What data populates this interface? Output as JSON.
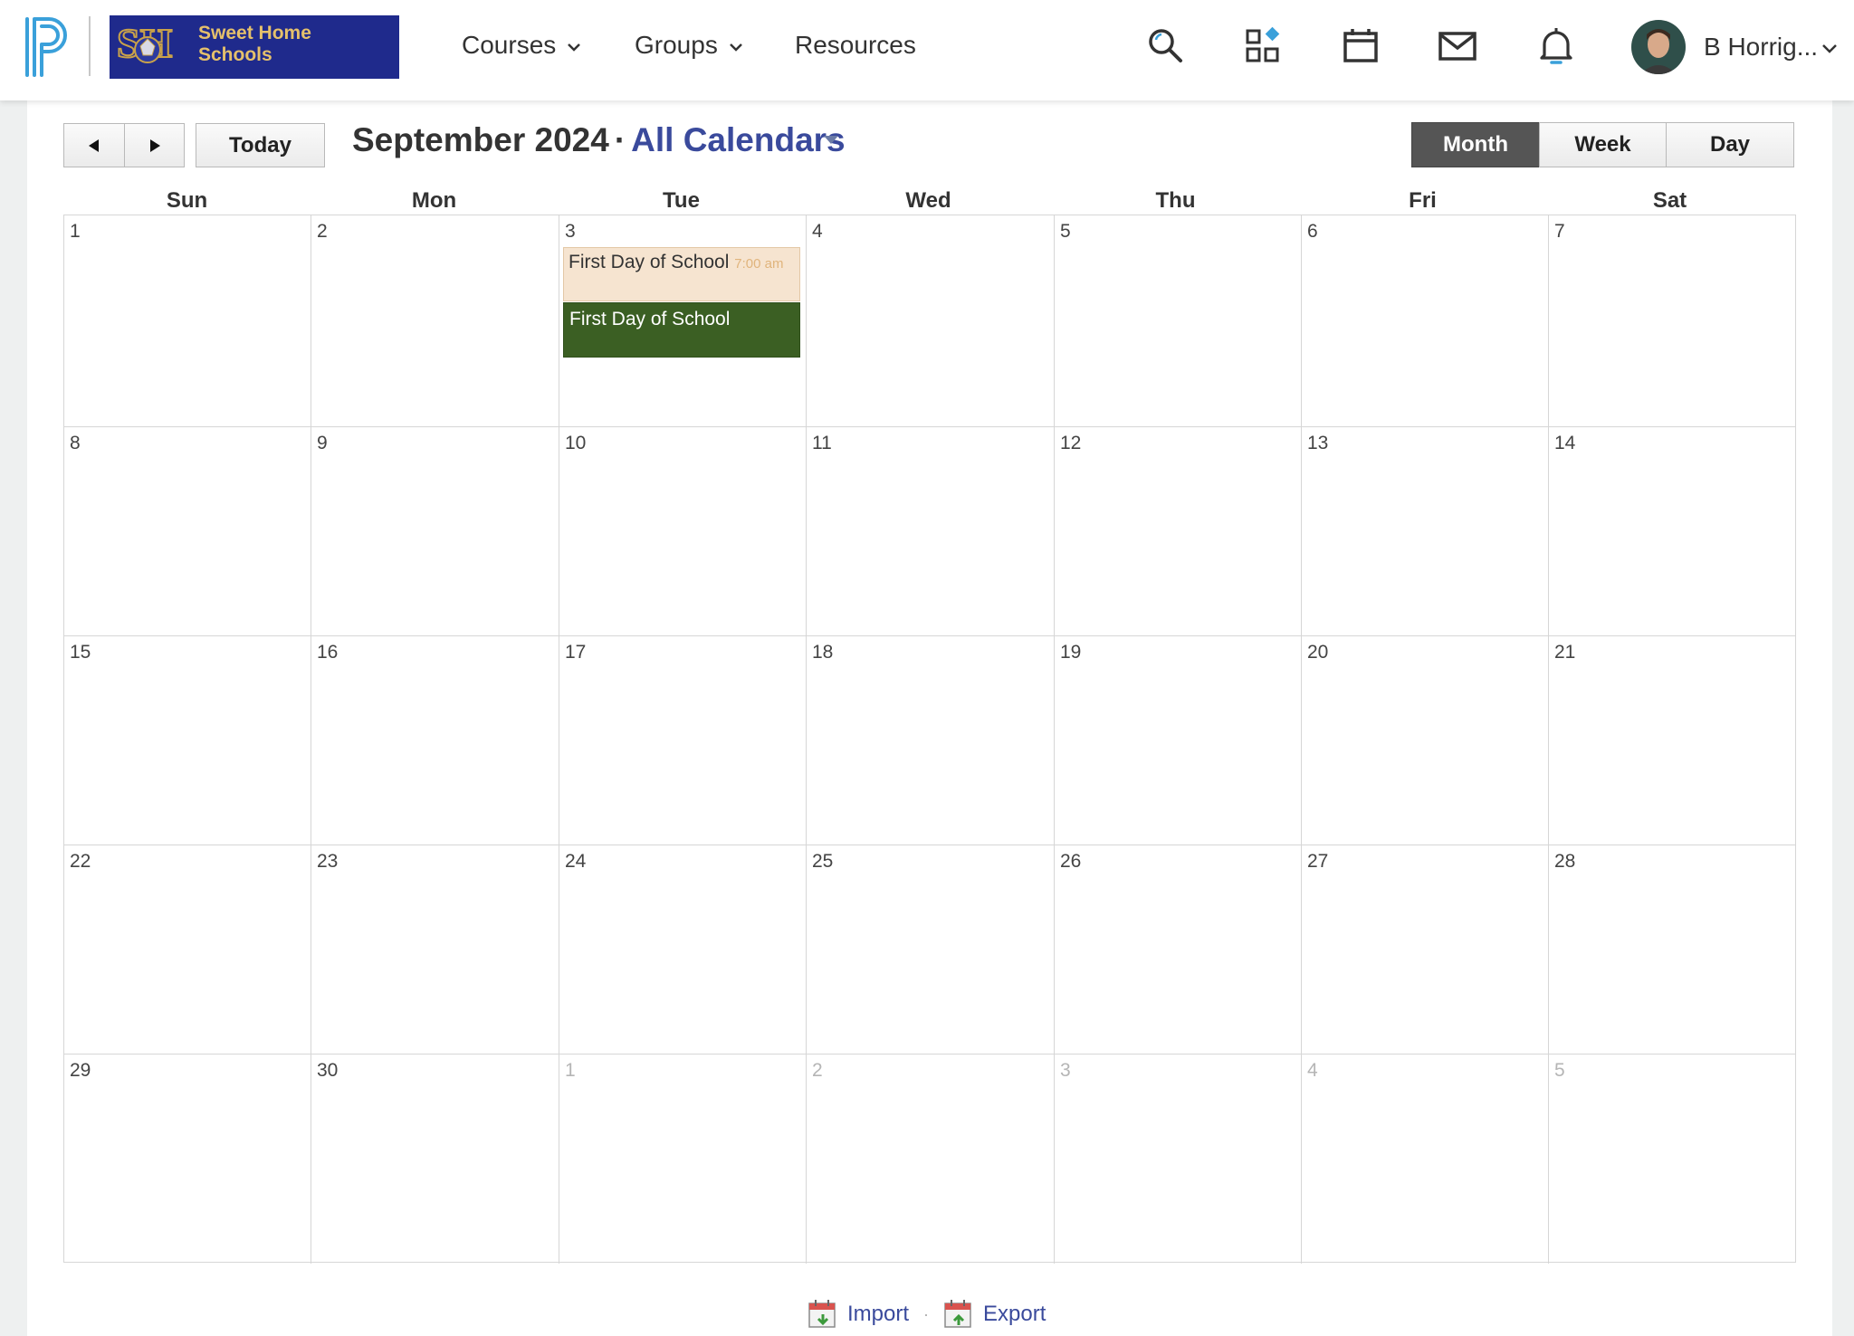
{
  "header": {
    "school_name": "Sweet Home Schools",
    "nav": [
      {
        "label": "Courses"
      },
      {
        "label": "Groups"
      },
      {
        "label": "Resources"
      }
    ],
    "user_name": "B Horrig..."
  },
  "toolbar": {
    "today_label": "Today",
    "month_year": "September 2024",
    "separator": "·",
    "calendar_filter": "All Calendars",
    "views": [
      "Month",
      "Week",
      "Day"
    ],
    "active_view": "Month"
  },
  "weekdays": [
    "Sun",
    "Mon",
    "Tue",
    "Wed",
    "Thu",
    "Fri",
    "Sat"
  ],
  "weeks": [
    [
      "1",
      "2",
      "3",
      "4",
      "5",
      "6",
      "7"
    ],
    [
      "8",
      "9",
      "10",
      "11",
      "12",
      "13",
      "14"
    ],
    [
      "15",
      "16",
      "17",
      "18",
      "19",
      "20",
      "21"
    ],
    [
      "22",
      "23",
      "24",
      "25",
      "26",
      "27",
      "28"
    ],
    [
      "29",
      "30",
      "1",
      "2",
      "3",
      "4",
      "5"
    ]
  ],
  "events": [
    {
      "title": "First Day of School",
      "time": "7:00 am",
      "date": "2024-09-03",
      "color": "#f6e4d0"
    },
    {
      "title": "First Day of School",
      "date": "2024-09-03",
      "color": "#3b5f23"
    }
  ],
  "footer": {
    "import_label": "Import",
    "export_label": "Export",
    "separator": "·"
  },
  "colors": {
    "accent": "#3a4a9c",
    "active_view_bg": "#555555",
    "school_logo_bg": "#1f2a8c",
    "powerschool_blue": "#3aa0da"
  }
}
